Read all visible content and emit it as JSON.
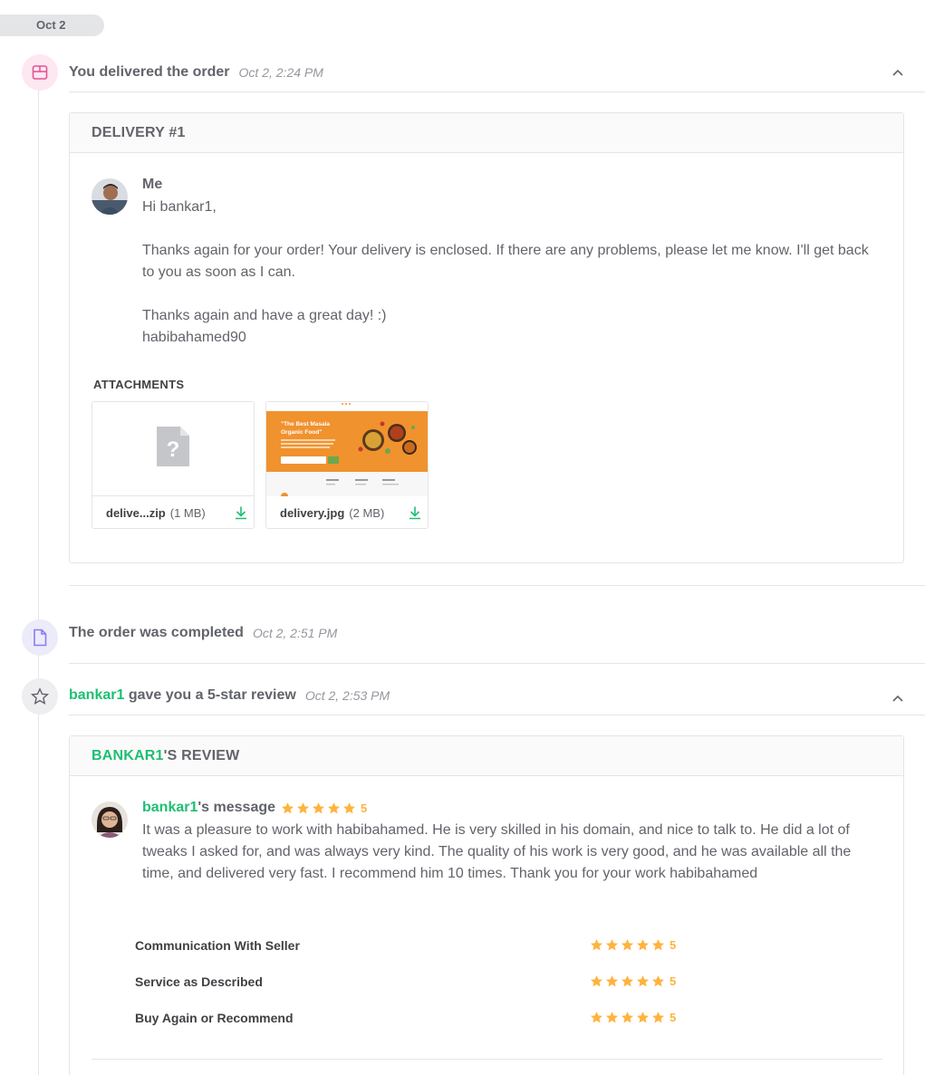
{
  "date_pill": "Oct 2",
  "events": {
    "delivered": {
      "title": "You delivered the order",
      "time": "Oct 2, 2:24 PM"
    },
    "completed": {
      "title": "The order was completed",
      "time": "Oct 2, 2:51 PM"
    },
    "review": {
      "user": "bankar1",
      "title_rest": " gave you a 5-star review",
      "time": "Oct 2, 2:53 PM"
    }
  },
  "delivery": {
    "header": "DELIVERY #1",
    "sender": "Me",
    "message": {
      "greeting": "Hi bankar1,",
      "body": "Thanks again for your order! Your delivery is enclosed. If there are any problems, please let me know. I'll get back to you as soon as I can.",
      "closing": "Thanks again and have a great day! :)",
      "signature": "habibahamed90"
    },
    "attachments_title": "ATTACHMENTS",
    "attachments": [
      {
        "name": "delive...zip",
        "size": "(1 MB)",
        "thumb_icon": "unknown-file-icon"
      },
      {
        "name": "delivery.jpg",
        "size": "(2 MB)",
        "thumb_icon": "image-thumbnail",
        "preview": {
          "headline_1": "\"The Best Masala",
          "headline_2": "Organic Food\""
        }
      }
    ]
  },
  "review": {
    "header_user": "BANKAR1",
    "header_rest": "'S REVIEW",
    "sender_user": "bankar1",
    "sender_rest": "'s message",
    "rating": 5,
    "rating_label": "5",
    "message": "It was a pleasure to work with habibahamed. He is very skilled in his domain, and nice to talk to. He did a lot of tweaks I asked for, and was always very kind. The quality of his work is very good, and he was available all the time, and delivered very fast. I recommend him 10 times. Thank you for your work habibahamed",
    "criteria": [
      {
        "label": "Communication With Seller",
        "rating": 5,
        "rating_label": "5"
      },
      {
        "label": "Service as Described",
        "rating": 5,
        "rating_label": "5"
      },
      {
        "label": "Buy Again or Recommend",
        "rating": 5,
        "rating_label": "5"
      }
    ]
  },
  "colors": {
    "accent": "#1dbf73",
    "star": "#ffb33e",
    "text": "#62646a",
    "border": "#e4e5e7"
  }
}
